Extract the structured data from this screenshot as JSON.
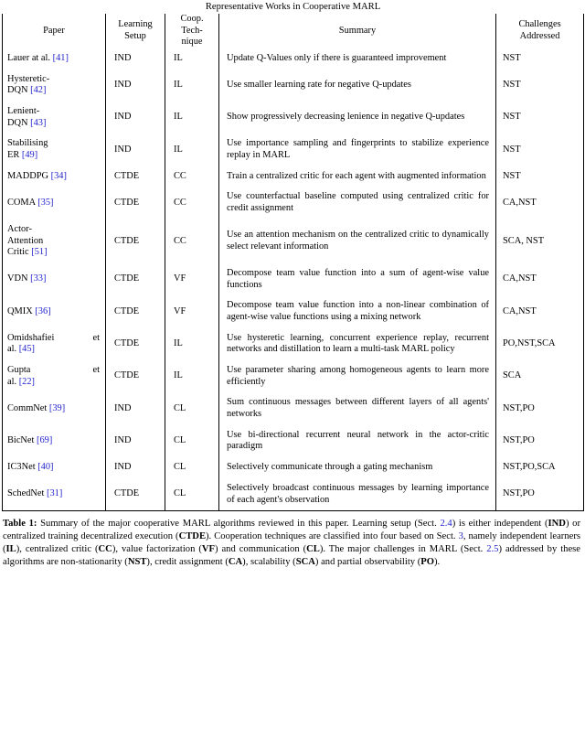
{
  "table": {
    "title": "Representative Works in Cooperative MARL",
    "columns": [
      {
        "id": "paper",
        "header": "Paper"
      },
      {
        "id": "learning_setup",
        "header_line1": "Learning",
        "header_line2": "Setup"
      },
      {
        "id": "coop_technique",
        "header_line1": "Coop.",
        "header_line2": "Tech-",
        "header_line3": "nique"
      },
      {
        "id": "summary",
        "header": "Summary"
      },
      {
        "id": "challenges",
        "header_line1": "Challenges",
        "header_line2": "Addressed"
      }
    ],
    "rows": [
      {
        "paper": "Lauer at al.",
        "paper_ref": "[41]",
        "paper_spread": false,
        "learning_setup": "IND",
        "coop_technique": "IL",
        "summary": "Update Q-Values only if there is guaranteed improvement",
        "challenges": "NST"
      },
      {
        "paper": "Hysteretic-\nDQN",
        "paper_ref": "[42]",
        "paper_spread": false,
        "learning_setup": "IND",
        "coop_technique": "IL",
        "summary": "Use smaller learning rate for negative Q-updates",
        "challenges": "NST"
      },
      {
        "paper": "Lenient-\nDQN",
        "paper_ref": "[43]",
        "paper_spread": false,
        "learning_setup": "IND",
        "coop_technique": "IL",
        "summary": "Show progressively decreasing lenience in negative Q-updates",
        "challenges": "NST"
      },
      {
        "paper": "Stabilising\nER",
        "paper_ref": "[49]",
        "paper_spread": false,
        "learning_setup": "IND",
        "coop_technique": "IL",
        "summary": "Use importance sampling and fingerprints to stabilize experience replay in MARL",
        "challenges": "NST"
      },
      {
        "paper": "MADDPG",
        "paper_ref": "[34]",
        "paper_spread": false,
        "learning_setup": "CTDE",
        "coop_technique": "CC",
        "summary": "Train a centralized critic for each agent with augmented information",
        "challenges": "NST"
      },
      {
        "paper": "COMA",
        "paper_ref": "[35]",
        "paper_spread": false,
        "learning_setup": "CTDE",
        "coop_technique": "CC",
        "summary": "Use counterfactual baseline computed using centralized critic for credit assignment",
        "challenges": "CA,NST"
      },
      {
        "paper": "Actor-\nAttention\nCritic",
        "paper_ref": "[51]",
        "paper_spread": false,
        "learning_setup": "CTDE",
        "coop_technique": "CC",
        "summary": "Use an attention mechanism on the centralized critic to dynamically select relevant information",
        "challenges": "SCA, NST"
      },
      {
        "paper": "VDN",
        "paper_ref": "[33]",
        "paper_spread": false,
        "learning_setup": "CTDE",
        "coop_technique": "VF",
        "summary": "Decompose team value function into a sum of agent-wise value functions",
        "challenges": "CA,NST"
      },
      {
        "paper": "QMIX",
        "paper_ref": "[36]",
        "paper_spread": false,
        "learning_setup": "CTDE",
        "coop_technique": "VF",
        "summary": "Decompose team value function into a non-linear combination of agent-wise value functions using a mixing network",
        "challenges": "CA,NST"
      },
      {
        "paper": "Omidshafiei et\nal.",
        "paper_ref": "[45]",
        "paper_spread": true,
        "learning_setup": "CTDE",
        "coop_technique": "IL",
        "summary": "Use hysteretic learning, concurrent experience replay, recurrent networks and distillation to learn a multi-task MARL policy",
        "challenges": "PO,NST,SCA"
      },
      {
        "paper": "Gupta et\nal.",
        "paper_ref": "[22]",
        "paper_spread": true,
        "learning_setup": "CTDE",
        "coop_technique": "IL",
        "summary": "Use parameter sharing among homogeneous agents to learn more efficiently",
        "challenges": "SCA"
      },
      {
        "paper": "CommNet",
        "paper_ref": "[39]",
        "paper_spread": false,
        "learning_setup": "IND",
        "coop_technique": "CL",
        "summary": "Sum continuous messages between different layers of all agents' networks",
        "challenges": "NST,PO"
      },
      {
        "paper": "BicNet",
        "paper_ref": "[69]",
        "paper_spread": false,
        "learning_setup": "IND",
        "coop_technique": "CL",
        "summary": "Use bi-directional recurrent neural network in the actor-critic paradigm",
        "challenges": "NST,PO"
      },
      {
        "paper": "IC3Net",
        "paper_ref": "[40]",
        "paper_spread": false,
        "learning_setup": "IND",
        "coop_technique": "CL",
        "summary": "Selectively communicate through a gating mechanism",
        "challenges": "NST,PO,SCA"
      },
      {
        "paper": "SchedNet",
        "paper_ref": "[31]",
        "paper_spread": false,
        "learning_setup": "CTDE",
        "coop_technique": "CL",
        "summary": "Selectively broadcast continuous messages by learning importance of each agent's observation",
        "challenges": "NST,PO"
      }
    ]
  },
  "caption": {
    "label": "Table 1",
    "separator": ":",
    "part1": "Summary of the major cooperative MARL algorithms reviewed in this paper. Learning setup (Sect. ",
    "sect_ref_1": "2.4",
    "part2": ") is either independent (",
    "bold_ind": "IND",
    "part3": ") or centralized training decentralized execution (",
    "bold_ctde": "CTDE",
    "part4": "). Cooperation techniques are classified into four based on Sect. ",
    "sect_ref_2": "3",
    "part5": ", namely independent learners (",
    "bold_il": "IL",
    "part6": "), centralized critic (",
    "bold_cc": "CC",
    "part7": "), value factorization (",
    "bold_vf": "VF",
    "part8": ") and communication (",
    "bold_cl": "CL",
    "part9": "). The major challenges in MARL (Sect. ",
    "sect_ref_3": "2.5",
    "part10": ") addressed by these algorithms are non-stationarity (",
    "bold_nst": "NST",
    "part11": "), credit assignment (",
    "bold_ca": "CA",
    "part12": "), scalability (",
    "bold_sca": "SCA",
    "part13": ") and partial observability (",
    "bold_po": "PO",
    "part14": ")."
  },
  "colors": {
    "link": "#2222cc",
    "text": "#000000",
    "rule": "#000000",
    "background": "#ffffff"
  }
}
